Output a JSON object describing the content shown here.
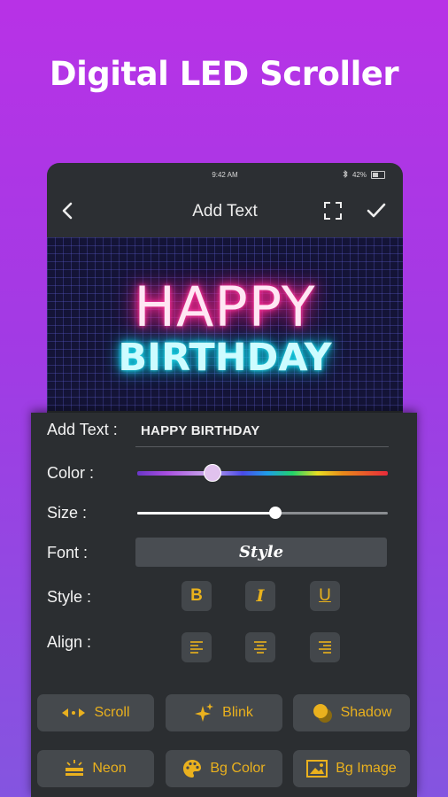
{
  "headline": "Digital LED Scroller",
  "status": {
    "time": "9:42 AM",
    "battery": "42%"
  },
  "appbar": {
    "title": "Add Text"
  },
  "preview": {
    "line1": "HAPPY",
    "line2": "BIRTHDAY"
  },
  "panel": {
    "add_text_label": "Add Text :",
    "add_text_value": "HAPPY BIRTHDAY",
    "color_label": "Color :",
    "color_value_fraction": 0.3,
    "size_label": "Size :",
    "size_value_fraction": 0.55,
    "font_label": "Font :",
    "font_button": "Style",
    "style_label": "Style :",
    "style_buttons": {
      "bold": "B",
      "italic": "I",
      "underline": "U"
    },
    "align_label": "Align :"
  },
  "actions": {
    "scroll": "Scroll",
    "blink": "Blink",
    "shadow": "Shadow",
    "neon": "Neon",
    "bg_color": "Bg Color",
    "bg_image": "Bg Image"
  },
  "colors": {
    "accent": "#eab11e",
    "panel": "#2b2e31",
    "neon_pink": "#ff2a90",
    "neon_cyan": "#10c8de"
  }
}
